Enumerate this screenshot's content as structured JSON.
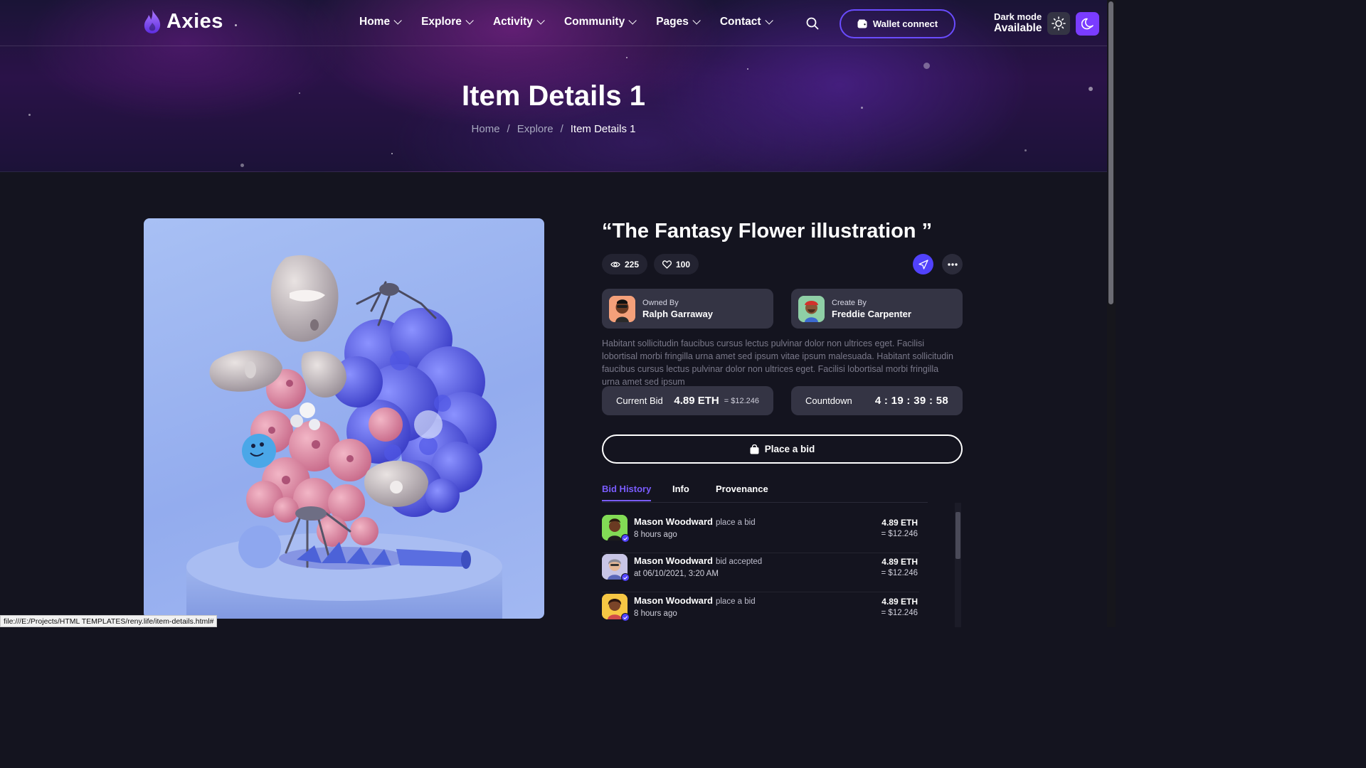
{
  "brand": {
    "name": "Axies"
  },
  "nav": {
    "items": [
      {
        "label": "Home"
      },
      {
        "label": "Explore"
      },
      {
        "label": "Activity"
      },
      {
        "label": "Community"
      },
      {
        "label": "Pages"
      },
      {
        "label": "Contact"
      }
    ],
    "wallet_label": "Wallet connect",
    "dark_mode_line1": "Dark mode",
    "dark_mode_line2": "Available",
    "icons": {
      "search": "search-icon",
      "wallet": "wallet-icon",
      "light": "sun-icon",
      "dark": "moon-icon"
    }
  },
  "hero": {
    "title": "Item Details 1",
    "breadcrumb": [
      "Home",
      "Explore",
      "Item Details 1"
    ]
  },
  "item": {
    "title": "“The Fantasy Flower illustration ”",
    "views": "225",
    "likes": "100",
    "owner": {
      "role": "Owned By",
      "name": "Ralph Garraway"
    },
    "creator": {
      "role": "Create By",
      "name": "Freddie Carpenter"
    },
    "description": "Habitant sollicitudin faucibus cursus lectus pulvinar dolor non ultrices eget. Facilisi lobortisal morbi fringilla urna amet sed ipsum vitae ipsum malesuada. Habitant sollicitudin faucibus cursus lectus pulvinar dolor non ultrices eget. Facilisi lobortisal morbi fringilla urna amet sed ipsum",
    "current_bid_label": "Current Bid",
    "current_bid_value": "4.89 ETH",
    "current_bid_usd": "= $12.246",
    "countdown_label": "Countdown",
    "countdown_value": "4 : 19 : 39 : 58",
    "place_bid_label": "Place a bid"
  },
  "tabs": [
    {
      "label": "Bid History",
      "active": true
    },
    {
      "label": "Info",
      "active": false
    },
    {
      "label": "Provenance",
      "active": false
    }
  ],
  "history": [
    {
      "name": "Mason Woodward",
      "action": "place a bid",
      "time": "8 hours ago",
      "eth": "4.89 ETH",
      "usd": "= $12.246"
    },
    {
      "name": "Mason Woodward",
      "action": "bid accepted",
      "time": "at 06/10/2021, 3:20 AM",
      "eth": "4.89 ETH",
      "usd": "= $12.246"
    },
    {
      "name": "Mason Woodward",
      "action": "place a bid",
      "time": "8 hours ago",
      "eth": "4.89 ETH",
      "usd": "= $12.246"
    }
  ],
  "status_url": "file:///E:/Projects/HTML TEMPLATES/reny.life/item-details.html#",
  "colors": {
    "accent": "#5142fc",
    "accent_purple": "#7a3cff",
    "background": "#14141f",
    "card": "#343444"
  }
}
